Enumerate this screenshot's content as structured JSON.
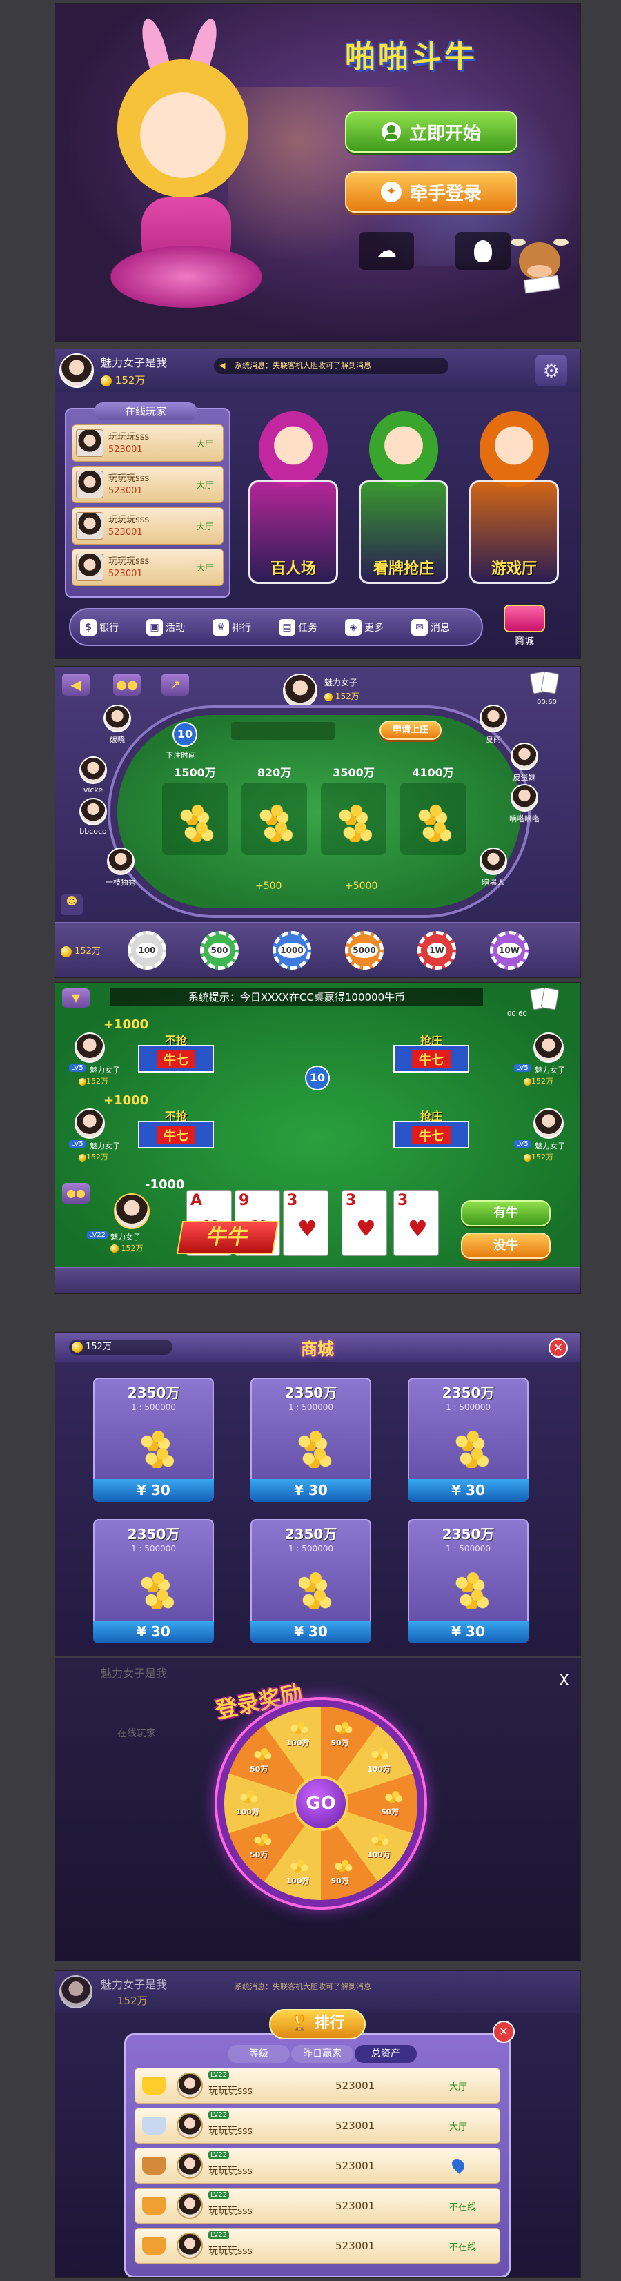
{
  "login": {
    "title": "啪啪斗牛",
    "start_label": "立即开始",
    "wechat_login_label": "牵手登录"
  },
  "lobby": {
    "user_name": "魅力女子是我",
    "coins": "152万",
    "system_message": "系统消息：失联客机大胆收可了解到消息",
    "online_title": "在线玩家",
    "online_players": [
      {
        "name": "玩玩玩sss",
        "id": "523001",
        "status": "大厅"
      },
      {
        "name": "玩玩玩sss",
        "id": "523001",
        "status": "大厅"
      },
      {
        "name": "玩玩玩sss",
        "id": "523001",
        "status": "大厅"
      },
      {
        "name": "玩玩玩sss",
        "id": "523001",
        "status": "大厅"
      }
    ],
    "modes": [
      {
        "label": "百人场",
        "color": "#c3279f"
      },
      {
        "label": "看牌抢庄",
        "color": "#3aa52c"
      },
      {
        "label": "游戏厅",
        "color": "#e36d0f"
      }
    ],
    "nav": [
      "银行",
      "活动",
      "排行",
      "任务",
      "更多",
      "消息"
    ],
    "shop_label": "商城"
  },
  "hundred": {
    "dealer_name": "魅力女子",
    "dealer_coins": "152万",
    "countdown": "10",
    "countdown_label": "下注时间",
    "apply_banker": "申请上庄",
    "timer": "00:60",
    "bets": [
      "1500万",
      "820万",
      "3500万",
      "4100万"
    ],
    "plus": [
      "+500",
      "+5000"
    ],
    "players_left": [
      "破晓",
      "vicke",
      "bbcoco",
      "一枝独秀"
    ],
    "players_right": [
      "夏雨",
      "皮蛋妹",
      "嘀嗒嘀嗒",
      "暗黑人"
    ],
    "my_coins": "152万",
    "chips": [
      {
        "label": "100",
        "color": "#d9d9d9"
      },
      {
        "label": "500",
        "color": "#3fb650"
      },
      {
        "label": "1000",
        "color": "#3d7be0"
      },
      {
        "label": "5000",
        "color": "#f08a24"
      },
      {
        "label": "1W",
        "color": "#e13b3b"
      },
      {
        "label": "10W",
        "color": "#a45ad8"
      }
    ]
  },
  "grab": {
    "notice": "系统提示：今日XXXX在CC桌赢得100000牛币",
    "timer": "00:60",
    "center_count": "10",
    "seats": [
      {
        "score": "+1000",
        "status": "不抢",
        "result": "牛七",
        "level": "LV5",
        "name": "魅力女子",
        "coins": "152万"
      },
      {
        "score": "+1000",
        "status": "不抢",
        "result": "牛七",
        "level": "LV5",
        "name": "魅力女子",
        "coins": "152万"
      },
      {
        "score": "",
        "status": "抢庄",
        "result": "牛七",
        "level": "LV5",
        "name": "魅力女子",
        "coins": "152万"
      },
      {
        "score": "",
        "status": "抢庄",
        "result": "牛七",
        "level": "LV5",
        "name": "魅力女子",
        "coins": "152万"
      }
    ],
    "me": {
      "score": "-1000",
      "level": "LV22",
      "name": "魅力女子",
      "coins": "152万"
    },
    "cards": [
      "A",
      "9",
      "3",
      "3",
      "3"
    ],
    "hand_result": "牛牛",
    "has_bull": "有牛",
    "no_bull": "没牛"
  },
  "shop": {
    "title": "商城",
    "coins": "152万",
    "items": [
      {
        "amount": "2350万",
        "rate": "1 : 500000",
        "price": "¥ 30"
      },
      {
        "amount": "2350万",
        "rate": "1 : 500000",
        "price": "¥ 30"
      },
      {
        "amount": "2350万",
        "rate": "1 : 500000",
        "price": "¥ 30"
      },
      {
        "amount": "2350万",
        "rate": "1 : 500000",
        "price": "¥ 30"
      },
      {
        "amount": "2350万",
        "rate": "1 : 500000",
        "price": "¥ 30"
      },
      {
        "amount": "2350万",
        "rate": "1 : 500000",
        "price": "¥ 30"
      }
    ]
  },
  "wheel": {
    "title": "登录奖励",
    "go": "GO",
    "slices": [
      "50万",
      "100万",
      "50万",
      "100万",
      "50万",
      "100万",
      "50万",
      "100万",
      "50万",
      "100万"
    ],
    "close": "X"
  },
  "rank": {
    "title": "排行",
    "tabs": [
      "等级",
      "昨日赢家",
      "总资产"
    ],
    "rows": [
      {
        "level": "LV22",
        "name": "玩玩玩sss",
        "id": "523001",
        "status": "大厅"
      },
      {
        "level": "LV22",
        "name": "玩玩玩sss",
        "id": "523001",
        "status": "大厅"
      },
      {
        "level": "LV22",
        "name": "玩玩玩sss",
        "id": "523001",
        "status": ""
      },
      {
        "level": "LV22",
        "name": "玩玩玩sss",
        "id": "523001",
        "status": "不在线"
      },
      {
        "level": "LV22",
        "name": "玩玩玩sss",
        "id": "523001",
        "status": "不在线"
      }
    ]
  }
}
